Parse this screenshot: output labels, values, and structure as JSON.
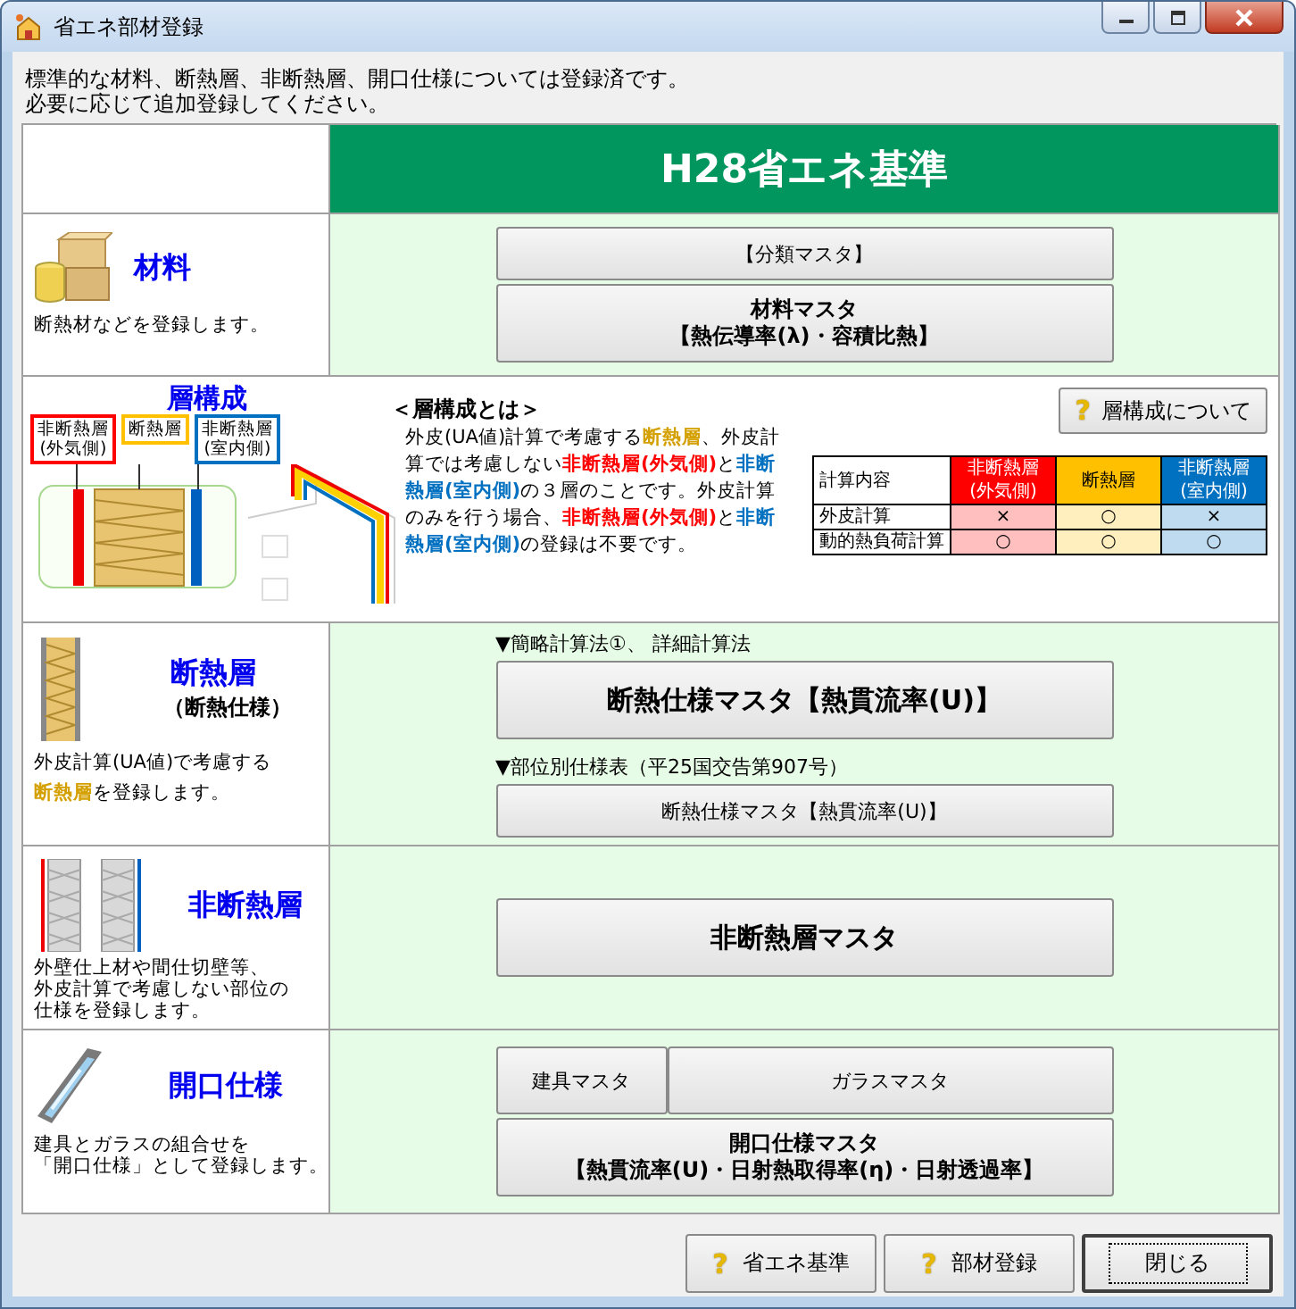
{
  "window": {
    "title": "省エネ部材登録"
  },
  "intro": [
    "標準的な材料、断熱層、非断熱層、開口仕様については登録済です。",
    "必要に応じて追加登録してください。"
  ],
  "header": "H28省エネ基準",
  "rows": [
    {
      "kind": "material",
      "title": "材料",
      "desc": [
        [
          {
            "kind": "plain",
            "text": "断熱材などを登録します。"
          }
        ]
      ],
      "groups": [
        {
          "buttons": [
            {
              "lines": [
                "【分類マスタ】"
              ],
              "kind": "normal"
            }
          ]
        },
        {
          "buttons": [
            {
              "lines": [
                "材料マスタ",
                "【熱伝導率(λ)・容積比熱】"
              ],
              "kind": "bold"
            }
          ]
        }
      ]
    },
    {
      "kind": "layer",
      "title": "層構成",
      "labels": [
        {
          "lines": [
            "非断熱層",
            "(外気側)"
          ],
          "color": "#ff0000"
        },
        {
          "lines": [
            "断熱層"
          ],
          "color": "#ffc000"
        },
        {
          "lines": [
            "非断熱層",
            "(室内側)"
          ],
          "color": "#0070c0"
        }
      ],
      "heading": "＜層構成とは＞",
      "desc": [
        {
          "kind": "plain",
          "text": "外皮(UA値)計算で考慮する"
        },
        {
          "kind": "insul",
          "text": "断熱層"
        },
        {
          "kind": "plain",
          "text": "、外皮計算では考慮しない"
        },
        {
          "kind": "outer",
          "text": "非断熱層(外気側)"
        },
        {
          "kind": "plain",
          "text": "と"
        },
        {
          "kind": "inner",
          "text": "非断熱層(室内側)"
        },
        {
          "kind": "plain",
          "text": "の３層のことです。外皮計算のみを行う場合、"
        },
        {
          "kind": "outer",
          "text": "非断熱層(外気側)"
        },
        {
          "kind": "plain",
          "text": "と"
        },
        {
          "kind": "inner",
          "text": "非断熱層(室内側)"
        },
        {
          "kind": "plain",
          "text": "の登録は不要です。"
        }
      ],
      "help_button": {
        "icon": "?",
        "label": "層構成について"
      },
      "table": {
        "columns": [
          {
            "lines": [
              "計算内容"
            ]
          },
          {
            "lines": [
              "非断熱層",
              "(外気側)"
            ],
            "color": "#ff0000"
          },
          {
            "lines": [
              "断熱層"
            ],
            "color": "#ffc000"
          },
          {
            "lines": [
              "非断熱層",
              "(室内側)"
            ],
            "color": "#0070c0"
          }
        ],
        "rows": [
          {
            "cells": [
              "外皮計算",
              "×",
              "○",
              "×"
            ]
          },
          {
            "cells": [
              "動的熱負荷計算",
              "○",
              "○",
              "○"
            ]
          }
        ]
      }
    },
    {
      "kind": "insulation",
      "title": "断熱層",
      "subtitle": "（断熱仕様）",
      "desc": [
        [
          {
            "kind": "plain",
            "text": "外皮計算(UA値)で考慮する"
          }
        ],
        [
          {
            "kind": "insul",
            "text": "断熱層"
          },
          {
            "kind": "plain",
            "text": "を登録します。"
          }
        ]
      ],
      "groups": [
        {
          "note": "▼簡略計算法①、 詳細計算法",
          "buttons": [
            {
              "lines": [
                "断熱仕様マスタ【熱貫流率(U)】"
              ],
              "kind": "large"
            }
          ]
        },
        {
          "note": "▼部位別仕様表（平25国交告第907号）",
          "buttons": [
            {
              "lines": [
                "断熱仕様マスタ【熱貫流率(U)】"
              ],
              "kind": "normal"
            }
          ]
        }
      ]
    },
    {
      "kind": "noninsulation",
      "title": "非断熱層",
      "desc": [
        [
          {
            "kind": "plain",
            "text": "外壁仕上材や間仕切壁等、"
          }
        ],
        [
          {
            "kind": "plain",
            "text": "外皮計算で考慮しない部位の"
          }
        ],
        [
          {
            "kind": "plain",
            "text": "仕様を登録します。"
          }
        ]
      ],
      "groups": [
        {
          "buttons": [
            {
              "lines": [
                "非断熱層マスタ"
              ],
              "kind": "large"
            }
          ]
        }
      ]
    },
    {
      "kind": "opening",
      "title": "開口仕様",
      "desc": [
        [
          {
            "kind": "plain",
            "text": "建具とガラスの組合せを"
          }
        ],
        [
          {
            "kind": "plain",
            "text": "「開口仕様」として登録します。"
          }
        ]
      ],
      "groups": [
        {
          "buttons": [
            {
              "lines": [
                "建具マスタ"
              ],
              "kind": "small"
            },
            {
              "lines": [
                "ガラスマスタ"
              ],
              "kind": "normal"
            }
          ]
        },
        {
          "buttons": [
            {
              "lines": [
                "開口仕様マスタ",
                "【熱貫流率(U)・日射熱取得率(η)・日射透過率】"
              ],
              "kind": "bold"
            }
          ]
        }
      ]
    }
  ],
  "footer_buttons": [
    {
      "label": "省エネ基準",
      "icon": "?",
      "focused": false
    },
    {
      "label": "部材登録",
      "icon": "?",
      "focused": false
    },
    {
      "label": "閉じる",
      "focused": true
    }
  ]
}
